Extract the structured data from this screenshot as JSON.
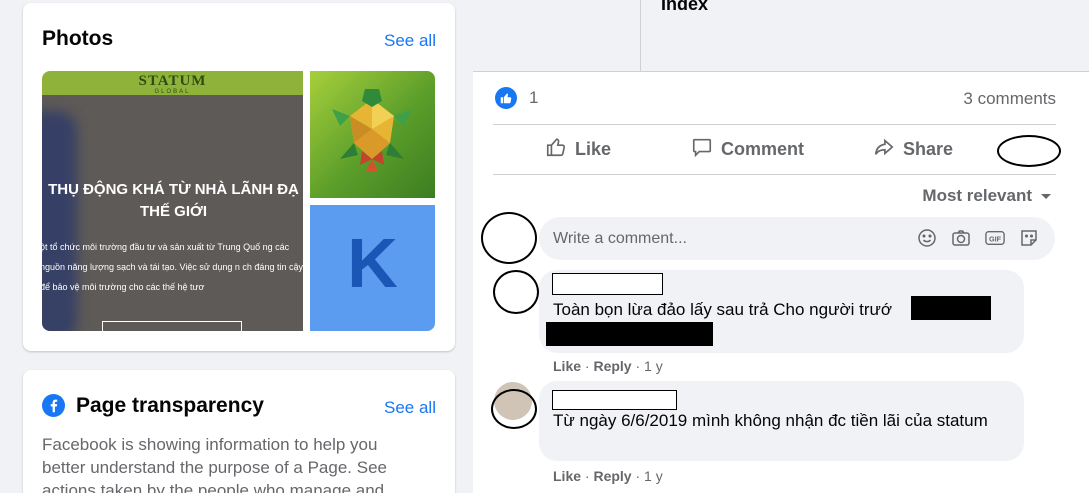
{
  "photos": {
    "title": "Photos",
    "see_all": "See all",
    "main_photo": {
      "brand": "STATUM",
      "brand_sub": "GLOBAL",
      "headline": "THỤ ĐỘNG KHÁ TỪ NHÀ LÃNH ĐẠ THẾ GIỚI",
      "body": "ột tổ chức môi trường đầu tư và sản xuất từ Trung Quố ng các nguồn năng lượng sạch và tái tạo. Việc sử dụng n ch đáng tin cậy để bảo vệ môi trường cho các thế hệ tươ"
    },
    "k_letter": "K"
  },
  "transparency": {
    "title": "Page transparency",
    "see_all": "See all",
    "text": "Facebook is showing information to help you better understand the purpose of a Page. See actions taken by the people who manage and"
  },
  "post": {
    "link_title": "Index",
    "reaction_count": "1",
    "comment_count": "3 comments",
    "actions": {
      "like": "Like",
      "comment": "Comment",
      "share": "Share"
    },
    "sort_label": "Most relevant",
    "write_placeholder": "Write a comment...",
    "comments": [
      {
        "text": "Toàn bọn lừa đảo lấy sau trả Cho người trướ",
        "like": "Like",
        "reply": "Reply",
        "time": "1 y"
      },
      {
        "text": "Từ ngày 6/6/2019 mình không nhận đc tiền lãi của statum",
        "like": "Like",
        "reply": "Reply",
        "time": "1 y"
      }
    ]
  },
  "colors": {
    "accent": "#1877f2",
    "muted": "#65676b",
    "bg": "#f0f2f5"
  }
}
